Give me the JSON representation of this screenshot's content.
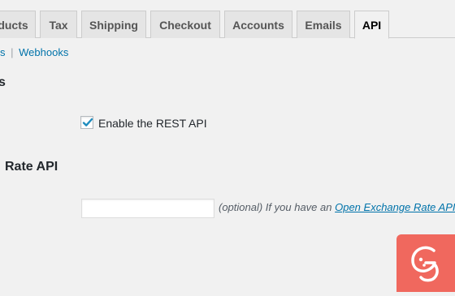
{
  "tabs": [
    {
      "label": "ducts",
      "active": false
    },
    {
      "label": "Tax",
      "active": false
    },
    {
      "label": "Shipping",
      "active": false
    },
    {
      "label": "Checkout",
      "active": false
    },
    {
      "label": "Accounts",
      "active": false
    },
    {
      "label": "Emails",
      "active": false
    },
    {
      "label": "API",
      "active": true
    }
  ],
  "subnav": {
    "prev_link": "s",
    "separator": "|",
    "current_link": "Webhooks"
  },
  "section1": {
    "heading": "s",
    "checkbox_label": "Enable the REST API",
    "checkbox_checked": true
  },
  "section2": {
    "heading": "Rate API",
    "input_value": "",
    "desc_prefix": "(optional) If you have an",
    "desc_link": "Open Exchange Rate API"
  },
  "colors": {
    "accent": "#0073aa",
    "checkmark": "#1e8cbe",
    "logo_badge": "#f0685e"
  },
  "icons": {
    "checkbox": "checkmark-icon",
    "logo": "g-logo-icon"
  }
}
